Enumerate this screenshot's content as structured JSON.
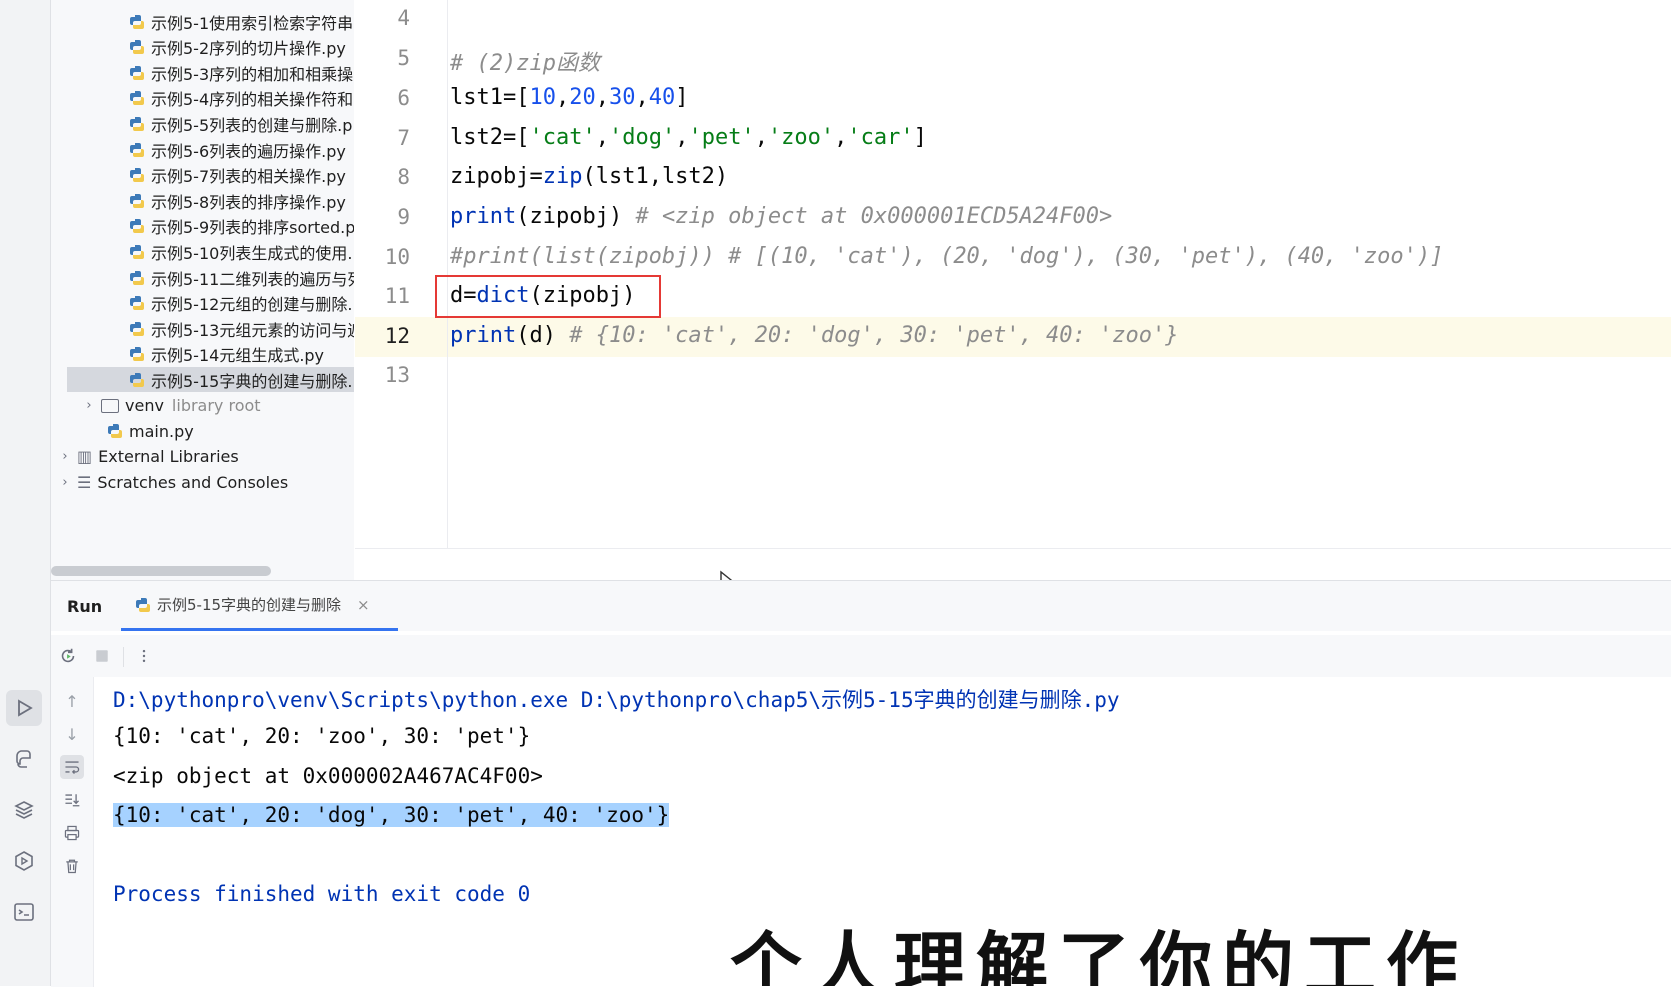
{
  "project_tree": {
    "files": [
      "示例5-1使用索引检索字符串",
      "示例5-2序列的切片操作.py",
      "示例5-3序列的相加和相乘操",
      "示例5-4序列的相关操作符和",
      "示例5-5列表的创建与删除.p",
      "示例5-6列表的遍历操作.py",
      "示例5-7列表的相关操作.py",
      "示例5-8列表的排序操作.py",
      "示例5-9列表的排序sorted.p",
      "示例5-10列表生成式的使用.",
      "示例5-11二维列表的遍历与列",
      "示例5-12元组的创建与删除.",
      "示例5-13元组元素的访问与遍",
      "示例5-14元组生成式.py",
      "示例5-15字典的创建与删除."
    ],
    "venv_label": "venv",
    "venv_note": "library root",
    "main_file": "main.py",
    "external_libraries": "External Libraries",
    "scratches": "Scratches and Consoles"
  },
  "editor": {
    "line_numbers": [
      "4",
      "5",
      "6",
      "7",
      "8",
      "9",
      "10",
      "11",
      "12",
      "13"
    ],
    "l5_comment": "# (2)zip函数",
    "l6_a": "lst1=[",
    "l6_n1": "10",
    "l6_c1": ",",
    "l6_n2": "20",
    "l6_c2": ",",
    "l6_n3": "30",
    "l6_c3": ",",
    "l6_n4": "40",
    "l6_b": "]",
    "l7_a": "lst2=[",
    "l7_s1": "'cat'",
    "l7_c1": ",",
    "l7_s2": "'dog'",
    "l7_c2": ",",
    "l7_s3": "'pet'",
    "l7_c3": ",",
    "l7_s4": "'zoo'",
    "l7_c4": ",",
    "l7_s5": "'car'",
    "l7_b": "]",
    "l8_a": "zipobj=",
    "l8_call": "zip",
    "l8_b": "(lst1,lst2)",
    "l9_call": "print",
    "l9_b": "(zipobj) ",
    "l9_comment": "# <zip object at 0x000001ECD5A24F00>",
    "l10_comment": "#print(list(zipobj)) # [(10, 'cat'), (20, 'dog'), (30, 'pet'), (40, 'zoo')]",
    "l11_a": "d=",
    "l11_call": "dict",
    "l11_b": "(zipobj)",
    "l12_call": "print",
    "l12_b": "(d) ",
    "l12_comment": "# {10: 'cat', 20: 'dog', 30: 'pet', 40: 'zoo'}"
  },
  "run_panel": {
    "title": "Run",
    "tab_label": "示例5-15字典的创建与删除",
    "tab_close": "×",
    "console": {
      "command": "D:\\pythonpro\\venv\\Scripts\\python.exe D:\\pythonpro\\chap5\\示例5-15字典的创建与删除.py",
      "line1": "{10: 'cat', 20: 'zoo', 30: 'pet'}",
      "line2": "<zip object at 0x000002A467AC4F00>",
      "line3": "{10: 'cat', 20: 'dog', 30: 'pet', 40: 'zoo'}",
      "finish": "Process finished with exit code 0"
    }
  },
  "overlay": {
    "partial_text": "个人理解了你的工作"
  },
  "colors": {
    "keyword_blue": "#0033b3",
    "number_blue": "#1750eb",
    "string_green": "#067d17",
    "comment_gray": "#8c8c8c",
    "highlight_red": "#e53935",
    "selection_blue": "#a6d2ff",
    "tab_underline": "#3574f0"
  }
}
